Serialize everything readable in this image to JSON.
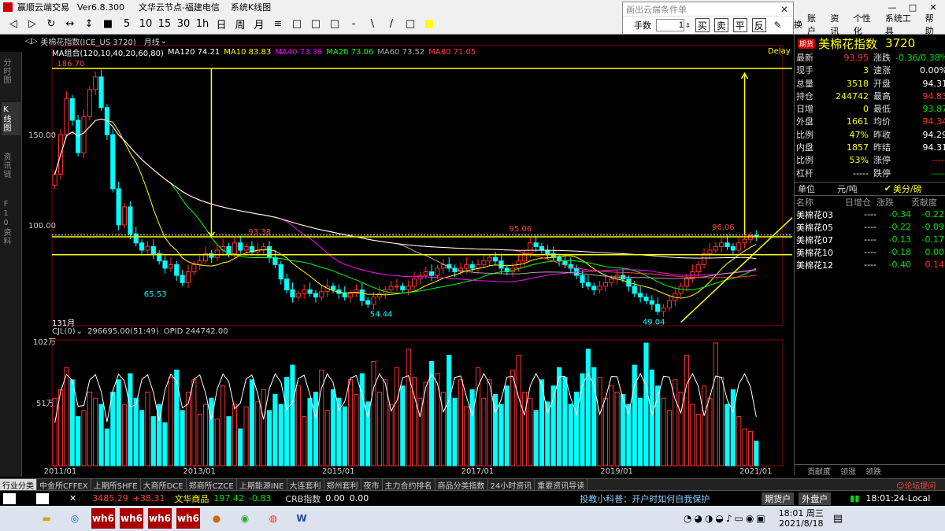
{
  "app": {
    "title_parts": [
      "赢顺云端交易",
      "Ver6.8.300",
      "文华云节点-福建电信",
      "系统K线图"
    ]
  },
  "toolbar": {
    "items": [
      "◁",
      "▷",
      "↻",
      "↔",
      "↕",
      "■",
      "5",
      "10",
      "15",
      "30",
      "1h",
      "日",
      "周",
      "月",
      "≡",
      "□",
      "□",
      "□",
      "-",
      "\\",
      "/",
      "□",
      "■"
    ],
    "menus": [
      "账户",
      "资讯",
      "个性化",
      "系统工具",
      "帮助"
    ],
    "menu_prefix": "换"
  },
  "cloud": {
    "caption": "画出云端条件单",
    "qty_label": "手数",
    "qty_value": "1",
    "buttons": [
      "买",
      "卖",
      "平",
      "反",
      "✎"
    ]
  },
  "vtabs": [
    "分时图",
    "K线图",
    "资讯链",
    "F10资料"
  ],
  "chart_header": {
    "symbol": "美棉花指数(ICE_US 3720)",
    "period": "月线"
  },
  "ma_bar": [
    {
      "text": "MA组合(120,10,40,20,60,80)",
      "color": "#ffffff"
    },
    {
      "text": "MA120 74.21",
      "color": "#ffffff"
    },
    {
      "text": "MA10 83.83",
      "color": "#ffff00"
    },
    {
      "text": "MA40 73.39",
      "color": "#ff00ff"
    },
    {
      "text": "MA20 73.06",
      "color": "#00ff00"
    },
    {
      "text": "MA60 73.52",
      "color": "#aaaaaa"
    },
    {
      "text": "MA80 71.05",
      "color": "#ff4040"
    }
  ],
  "delay_label": "Delay",
  "count_label": "131月",
  "price_labels": {
    "p186": "186.70",
    "p150": "150.00",
    "p100": "100.00",
    "p95": "95.06",
    "p93": "93.38",
    "p96": "96.06",
    "p65": "65.53",
    "p54": "54.44",
    "p49": "49.04"
  },
  "vol_bar": {
    "name": "CJL(0)",
    "values": "296695.00(51:49)",
    "opid": "OPID 244742.00"
  },
  "vol_axis": [
    "102万",
    "51万"
  ],
  "x_labels": [
    "2011/01",
    "2013/01",
    "2015/01",
    "2017/01",
    "2019/01",
    "2021/01"
  ],
  "chart_data": {
    "type": "candlestick",
    "title": "美棉花指数(ICE_US 3720) 月线",
    "ylim": [
      45,
      195
    ],
    "hlines": [
      93.4,
      94.3,
      83.5,
      186.7
    ],
    "labeled_extremes": [
      186.7,
      65.53,
      93.38,
      54.44,
      95.06,
      49.04,
      96.06
    ],
    "ma": {
      "MA120": 74.21,
      "MA10": 83.83,
      "MA40": 73.39,
      "MA20": 73.06,
      "MA60": 73.52,
      "MA80": 71.05
    },
    "close_series": [
      128,
      150,
      170,
      158,
      140,
      160,
      175,
      182,
      165,
      150,
      120,
      100,
      110,
      95,
      90,
      86,
      88,
      84,
      80,
      76,
      78,
      72,
      68,
      74,
      78,
      80,
      84,
      82,
      86,
      88,
      84,
      90,
      86,
      88,
      85,
      86,
      88,
      82,
      78,
      70,
      64,
      60,
      62,
      64,
      62,
      60,
      63,
      66,
      64,
      62,
      60,
      62,
      64,
      58,
      56,
      60,
      62,
      64,
      66,
      66,
      64,
      66,
      70,
      72,
      74,
      72,
      76,
      78,
      76,
      74,
      76,
      78,
      76,
      78,
      80,
      82,
      80,
      76,
      74,
      76,
      80,
      84,
      90,
      88,
      86,
      84,
      82,
      80,
      78,
      76,
      72,
      68,
      66,
      64,
      66,
      68,
      70,
      72,
      70,
      66,
      62,
      60,
      58,
      56,
      52,
      54,
      58,
      62,
      66,
      70,
      74,
      78,
      84,
      86,
      88,
      90,
      88,
      86,
      90,
      92,
      94,
      93.95
    ],
    "volume_series": [
      0.55,
      0.62,
      0.8,
      0.7,
      0.4,
      0.45,
      0.6,
      0.55,
      0.5,
      0.3,
      0.6,
      0.7,
      0.5,
      0.75,
      0.55,
      0.45,
      0.6,
      0.4,
      0.5,
      0.35,
      0.72,
      0.78,
      0.45,
      0.6,
      0.7,
      0.42,
      0.5,
      0.55,
      0.38,
      0.65,
      0.4,
      0.5,
      0.3,
      0.48,
      0.7,
      0.52,
      0.62,
      0.45,
      0.58,
      0.5,
      0.72,
      0.82,
      0.65,
      0.4,
      0.55,
      0.6,
      0.78,
      0.45,
      0.62,
      0.55,
      0.48,
      0.7,
      0.58,
      0.75,
      0.52,
      0.85,
      0.6,
      0.7,
      0.5,
      0.8,
      0.65,
      0.95,
      0.72,
      0.55,
      0.68,
      0.85,
      0.75,
      0.6,
      0.9,
      0.55,
      0.7,
      0.48,
      0.62,
      0.8,
      0.55,
      0.7,
      0.58,
      0.5,
      0.65,
      0.78,
      0.9,
      0.6,
      0.55,
      0.45,
      0.7,
      0.52,
      0.65,
      0.8,
      0.72,
      0.5,
      0.6,
      0.75,
      0.95,
      0.8,
      0.72,
      0.55,
      0.65,
      0.6,
      0.58,
      0.5,
      0.82,
      0.55,
      1.0,
      0.78,
      0.65,
      0.55,
      0.45,
      0.7,
      0.6,
      0.9,
      0.5,
      0.42,
      0.65,
      0.55,
      1.0,
      0.72,
      0.5,
      0.62,
      0.4,
      0.3,
      0.28,
      0.2
    ]
  },
  "quote": {
    "name": "美棉花指数",
    "code": "3720",
    "badge": "期货",
    "rows": [
      {
        "l1": "最新",
        "v1": "93.95",
        "c1": "red",
        "l2": "涨跌",
        "v2": "-0.36/0.38%",
        "c2": "grn"
      },
      {
        "l1": "现手",
        "v1": "3",
        "c1": "yel",
        "l2": "速涨",
        "v2": "0.00%",
        "c2": "wht"
      },
      {
        "l1": "总量",
        "v1": "3518",
        "c1": "yel",
        "l2": "开盘",
        "v2": "94.31",
        "c2": "wht"
      },
      {
        "l1": "持仓",
        "v1": "244742",
        "c1": "yel",
        "l2": "最高",
        "v2": "94.83",
        "c2": "red"
      },
      {
        "l1": "日增",
        "v1": "0",
        "c1": "yel",
        "l2": "最低",
        "v2": "93.87",
        "c2": "grn"
      },
      {
        "l1": "外盘",
        "v1": "1661",
        "c1": "yel",
        "l2": "均价",
        "v2": "94.34",
        "c2": "red"
      },
      {
        "l1": "比例",
        "v1": "47%",
        "c1": "yel",
        "l2": "昨收",
        "v2": "94.29",
        "c2": "wht"
      },
      {
        "l1": "内盘",
        "v1": "1857",
        "c1": "yel",
        "l2": "昨结",
        "v2": "94.31",
        "c2": "wht"
      },
      {
        "l1": "比例",
        "v1": "53%",
        "c1": "yel",
        "l2": "涨停",
        "v2": "-----",
        "c2": "red"
      },
      {
        "l1": "杠杆",
        "v1": "-----",
        "c1": "wht",
        "l2": "跌停",
        "v2": "-----",
        "c2": "grn"
      }
    ],
    "unit_label": "单位",
    "unit_value": "元/吨",
    "unit_alt": "美分/磅"
  },
  "contracts": {
    "headers": [
      "名称",
      "日增仓",
      "涨跌",
      "贡献度"
    ],
    "rows": [
      {
        "name": "美棉花03",
        "oi": "----",
        "chg": "-0.34",
        "contrib": "-0.22",
        "c": "grn"
      },
      {
        "name": "美棉花05",
        "oi": "----",
        "chg": "-0.22",
        "contrib": "-0.09",
        "c": "grn"
      },
      {
        "name": "美棉花07",
        "oi": "----",
        "chg": "-0.13",
        "contrib": "-0.17",
        "c": "grn"
      },
      {
        "name": "美棉花10",
        "oi": "----",
        "chg": "-0.18",
        "contrib": "0.00",
        "c": "grn"
      },
      {
        "name": "美棉花12",
        "oi": "----",
        "chg": "-0.40",
        "contrib": "0.14",
        "c": "grn"
      }
    ],
    "bottom_tabs": [
      "贡献度",
      "领涨",
      "领跌"
    ]
  },
  "market_tabs": [
    "行业分类",
    "中金所CFFEX",
    "上期所SHFE",
    "大商所DCE",
    "郑商所CZCE",
    "上期能源INE",
    "大连套利",
    "郑州套利",
    "夜市",
    "主力合约排名",
    "商品分类指数",
    "24小时资讯",
    "重要资讯导读"
  ],
  "forum": "论坛提问",
  "status": {
    "index1_val": "3485.29",
    "index1_chg": "+38.31",
    "index2_name": "文华商品",
    "index2_val": "197.42",
    "index2_chg": "-0.83",
    "index3_name": "CRB指数",
    "index3_val": "0.00",
    "index3_chg": "0.00",
    "tip": "投教小科普：开户时如何自我保护",
    "btn1": "期货户",
    "btn2": "外盘户",
    "clock": "18:01:24-Local"
  },
  "taskbar": {
    "time": "18:01 周三",
    "date": "2021/8/18"
  }
}
